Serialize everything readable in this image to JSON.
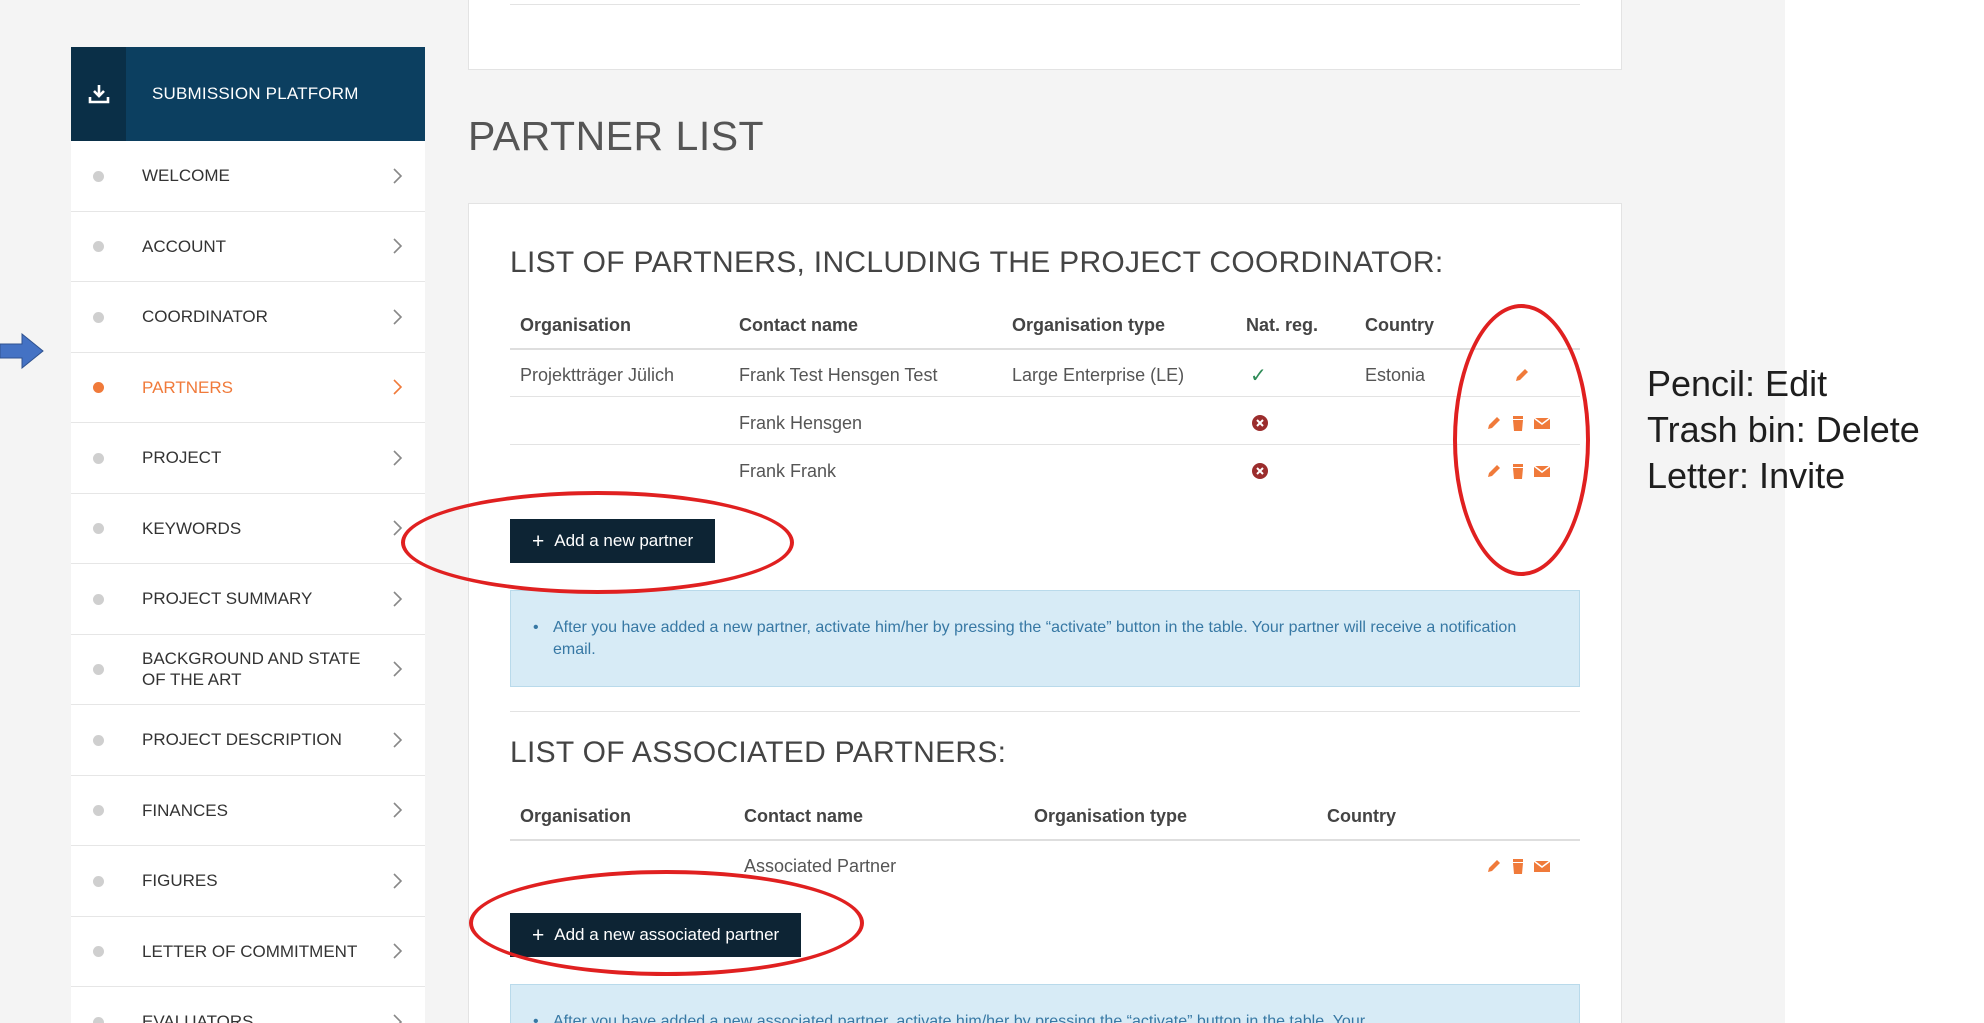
{
  "sidebar": {
    "header": "SUBMISSION PLATFORM",
    "items": [
      {
        "label": "WELCOME",
        "active": false
      },
      {
        "label": "ACCOUNT",
        "active": false
      },
      {
        "label": "COORDINATOR",
        "active": false
      },
      {
        "label": "PARTNERS",
        "active": true
      },
      {
        "label": "PROJECT",
        "active": false
      },
      {
        "label": "KEYWORDS",
        "active": false
      },
      {
        "label": "PROJECT SUMMARY",
        "active": false
      },
      {
        "label": "BACKGROUND AND STATE OF THE ART",
        "active": false
      },
      {
        "label": "PROJECT DESCRIPTION",
        "active": false
      },
      {
        "label": "FINANCES",
        "active": false
      },
      {
        "label": "FIGURES",
        "active": false
      },
      {
        "label": "LETTER OF COMMITMENT",
        "active": false
      },
      {
        "label": "EVALUATORS",
        "active": false
      }
    ]
  },
  "main": {
    "page_title": "PARTNER LIST",
    "partners": {
      "title": "LIST OF PARTNERS, INCLUDING THE PROJECT COORDINATOR:",
      "columns": [
        "Organisation",
        "Contact name",
        "Organisation type",
        "Nat. reg.",
        "Country"
      ],
      "rows": [
        {
          "organisation": "Projektträger Jülich",
          "contact": "Frank Test Hensgen Test",
          "type": "Large Enterprise (LE)",
          "nat_reg": "✓",
          "country": "Estonia"
        },
        {
          "organisation": "",
          "contact": "Frank Hensgen",
          "type": "",
          "nat_reg": "✕",
          "country": ""
        },
        {
          "organisation": "",
          "contact": "Frank Frank",
          "type": "",
          "nat_reg": "✕",
          "country": ""
        }
      ],
      "add_button": "Add a new partner",
      "info": "After you have added a new partner, activate him/her by pressing the “activate” button in the table. Your partner will receive a notification email."
    },
    "associated": {
      "title": "LIST OF ASSOCIATED PARTNERS:",
      "columns": [
        "Organisation",
        "Contact name",
        "Organisation type",
        "Country"
      ],
      "rows": [
        {
          "organisation": "",
          "contact": "Associated Partner",
          "type": "",
          "country": ""
        }
      ],
      "add_button": "Add a new associated partner",
      "info": "After you have added a new associated partner, activate him/her by pressing the “activate” button in the table. Your"
    }
  },
  "legend": {
    "lines": [
      "Pencil: Edit",
      "Trash bin: Delete",
      "Letter: Invite"
    ]
  },
  "colors": {
    "sidebar_header": "#0c3f60",
    "accent": "#f07a3a",
    "button": "#0d2434",
    "info_bg": "#d7ebf6",
    "annotation": "#e02020",
    "check": "#2e8b57",
    "cross": "#9b2d2d"
  },
  "icons": {
    "sidebar_header": "download-icon",
    "edit": "pencil-icon",
    "delete": "trash-icon",
    "invite": "envelope-icon",
    "nav": "chevron-right-icon",
    "pointer": "arrow-right-icon"
  }
}
